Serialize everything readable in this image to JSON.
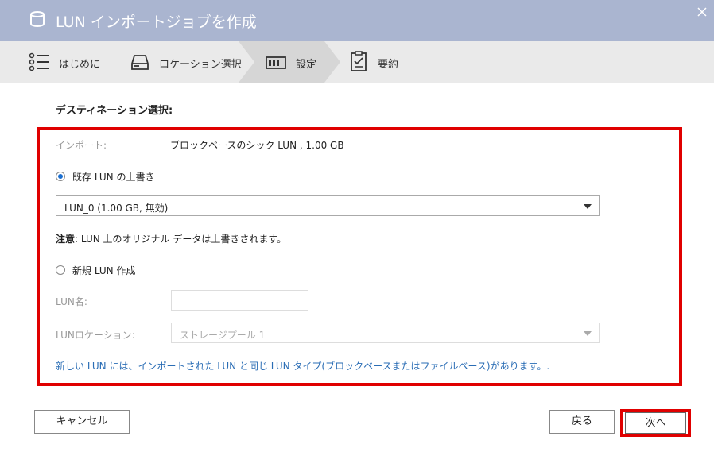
{
  "window": {
    "title": "LUN インポートジョブを作成",
    "icon": "database-icon",
    "close_icon": "close-icon"
  },
  "steps": [
    {
      "label": "はじめに",
      "icon": "list-icon",
      "active": false
    },
    {
      "label": "ロケーション選択",
      "icon": "drive-icon",
      "active": false
    },
    {
      "label": "設定",
      "icon": "settings-bars-icon",
      "active": true
    },
    {
      "label": "要約",
      "icon": "clipboard-icon",
      "active": false
    }
  ],
  "section_title": "デスティネーション選択:",
  "import": {
    "label": "インポート:",
    "value": "ブロックベースのシック LUN , 1.00 GB"
  },
  "overwrite": {
    "label": "既存 LUN の上書き",
    "selected": true,
    "select_value": "LUN_0 (1.00 GB, 無効)"
  },
  "warning": {
    "prefix": "注意",
    "text": ": LUN 上のオリジナル データは上書きされます。"
  },
  "new_lun": {
    "label": "新規 LUN 作成",
    "selected": false,
    "name_label": "LUN名:",
    "name_value": "",
    "location_label": "LUNロケーション:",
    "location_value": "ストレージプール 1"
  },
  "info_note": "新しい LUN には、インポートされた LUN と同じ LUN タイプ(ブロックベースまたはファイルベース)があります。.",
  "buttons": {
    "cancel": "キャンセル",
    "back": "戻る",
    "next": "次へ"
  },
  "colors": {
    "titlebar": "#aab5d0",
    "steps_bg": "#eaeaea",
    "highlight": "#e00000",
    "link_blue": "#2a6db5"
  }
}
